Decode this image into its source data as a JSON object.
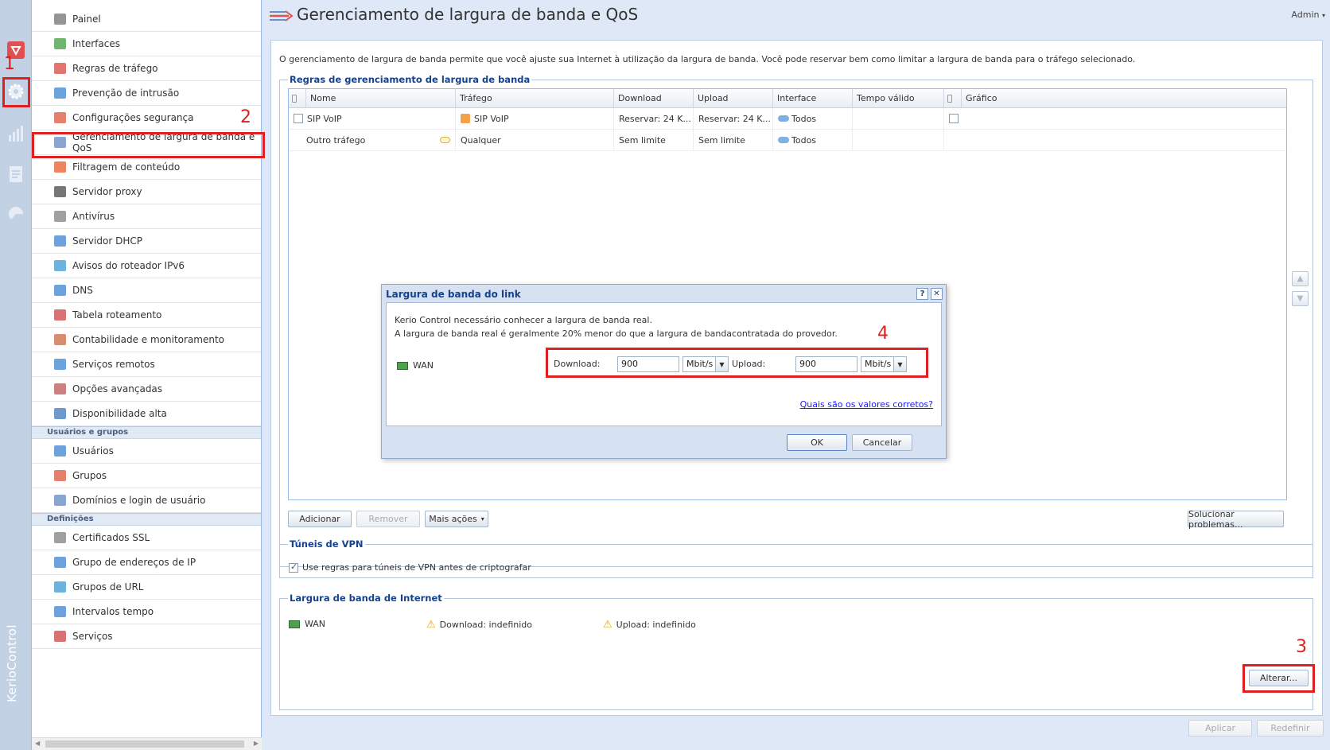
{
  "header": {
    "title": "Gerenciamento de largura de banda e QoS",
    "user": "Admin"
  },
  "rail": {
    "brand": "KerioControl",
    "items": [
      "dashboard-icon",
      "configuration-gear-icon",
      "stats-icon",
      "logs-icon",
      "status-icon"
    ]
  },
  "sidebar": {
    "items": [
      {
        "label": "Painel",
        "icon": "dashboard-icon"
      },
      {
        "label": "Interfaces",
        "icon": "network-card-icon"
      },
      {
        "label": "Regras de tráfego",
        "icon": "traffic-light-icon"
      },
      {
        "label": "Prevenção de intrusão",
        "icon": "shield-icon"
      },
      {
        "label": "Configurações segurança",
        "icon": "hand-stop-icon"
      },
      {
        "label": "Gerenciamento de largura de banda e QoS",
        "icon": "bandwidth-arrows-icon"
      },
      {
        "label": "Filtragem de conteúdo",
        "icon": "funnel-icon"
      },
      {
        "label": "Servidor proxy",
        "icon": "proxy-server-icon"
      },
      {
        "label": "Antivírus",
        "icon": "antivirus-icon"
      },
      {
        "label": "Servidor DHCP",
        "icon": "monitor-icon"
      },
      {
        "label": "Avisos do roteador IPv6",
        "icon": "ipv6-router-icon"
      },
      {
        "label": "DNS",
        "icon": "dns-tree-icon"
      },
      {
        "label": "Tabela roteamento",
        "icon": "routing-table-icon"
      },
      {
        "label": "Contabilidade e monitoramento",
        "icon": "accounting-icon"
      },
      {
        "label": "Serviços remotos",
        "icon": "cloud-icon"
      },
      {
        "label": "Opções avançadas",
        "icon": "advanced-gears-icon"
      },
      {
        "label": "Disponibilidade alta",
        "icon": "high-availability-icon"
      }
    ],
    "section_users": "Usuários e grupos",
    "user_items": [
      {
        "label": "Usuários",
        "icon": "user-icon"
      },
      {
        "label": "Grupos",
        "icon": "group-icon"
      },
      {
        "label": "Domínios e login de usuário",
        "icon": "domain-login-icon"
      }
    ],
    "section_definitions": "Definições",
    "definition_items": [
      {
        "label": "Certificados SSL",
        "icon": "certificate-icon"
      },
      {
        "label": "Grupo de endereços de IP",
        "icon": "ip-group-icon"
      },
      {
        "label": "Grupos de URL",
        "icon": "url-globe-icon"
      },
      {
        "label": "Intervalos tempo",
        "icon": "clock-icon"
      },
      {
        "label": "Serviços",
        "icon": "services-gear-icon"
      }
    ]
  },
  "main": {
    "intro": "O gerenciamento de largura de banda permite que você ajuste sua Internet à utilização da largura de banda. Você pode reservar bem como limitar a largura de banda para o tráfego selecionado.",
    "rules_legend": "Regras de gerenciamento de largura de banda",
    "columns": [
      "Nome",
      "Tráfego",
      "Download",
      "Upload",
      "Interface",
      "Tempo válido",
      "Gráfico"
    ],
    "rows": [
      {
        "name": "SIP VoIP",
        "traffic": "SIP VoIP",
        "download": "Reservar: 24 K...",
        "upload": "Reservar: 24 K...",
        "interface": "Todos",
        "time": "",
        "graph": ""
      },
      {
        "name": "Outro tráfego",
        "traffic": "Qualquer",
        "download": "Sem limite",
        "upload": "Sem limite",
        "interface": "Todos",
        "time": "",
        "graph": ""
      }
    ],
    "buttons": {
      "add": "Adicionar",
      "remove": "Remover",
      "more": "Mais ações",
      "troubleshoot": "Solucionar problemas..."
    },
    "vpn_legend": "Túneis de VPN",
    "vpn_checkbox": "Use regras para túneis de VPN antes de criptografar",
    "internet_legend": "Largura de banda de Internet",
    "internet": {
      "interface": "WAN",
      "download": "Download: indefinido",
      "upload": "Upload: indefinido"
    },
    "change_button": "Alterar...",
    "apply_button": "Aplicar",
    "reset_button": "Redefinir"
  },
  "dialog": {
    "title": "Largura de banda do link",
    "help_tool": "?",
    "close_tool": "✕",
    "line1": "Kerio Control necessário conhecer a largura de banda real.",
    "line2": "A largura de banda real é geralmente 20% menor do que a largura de bandacontratada do provedor.",
    "interface": "WAN",
    "download_label": "Download:",
    "download_value": "900",
    "download_unit": "Mbit/s",
    "upload_label": "Upload:",
    "upload_value": "900",
    "upload_unit": "Mbit/s",
    "help_link": "Quais são os valores corretos?",
    "ok": "OK",
    "cancel": "Cancelar"
  },
  "annotations": [
    "1",
    "2",
    "3",
    "4"
  ],
  "colors": {
    "annotation": "#e02020",
    "accent": "#15428b",
    "link": "#1a1aff"
  }
}
